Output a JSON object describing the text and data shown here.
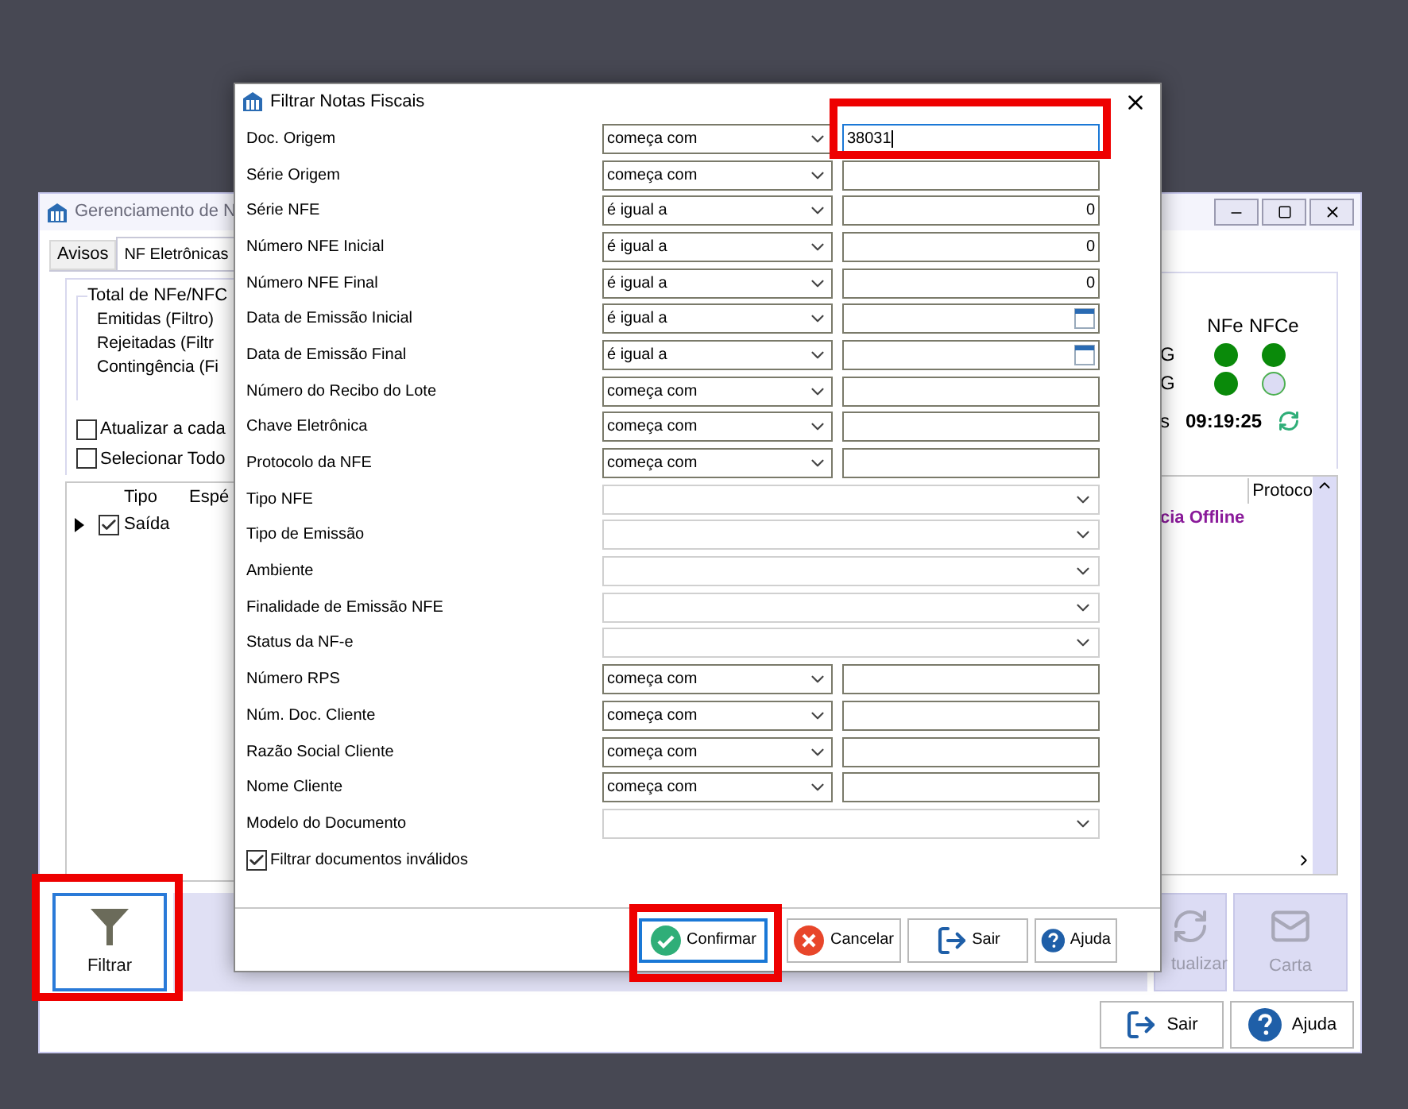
{
  "background_window": {
    "title": "Gerenciamento de N",
    "tabs": [
      {
        "label": "Avisos",
        "selected": false
      },
      {
        "label": "NF Eletrônicas",
        "selected": true
      }
    ],
    "totals": {
      "legend": "Total de NFe/NFC",
      "lines": [
        "Emitidas (Filtro)",
        "Rejeitadas (Filtr",
        "Contingência (Fi"
      ]
    },
    "options": [
      {
        "label": "Atualizar a cada",
        "checked": false
      },
      {
        "label": "Selecionar Todo",
        "checked": false
      }
    ],
    "status": {
      "columns": [
        "NFe",
        "NFCe"
      ],
      "rows": [
        {
          "label": "G",
          "lights": [
            {
              "on": true
            },
            {
              "on": true
            }
          ]
        },
        {
          "label": "G",
          "lights": [
            {
              "on": true
            },
            {
              "on": false
            }
          ]
        }
      ],
      "time_label": "s",
      "time": "09:19:25"
    },
    "grid": {
      "columns": [
        "Tipo",
        "Espé"
      ],
      "column_right": "Protoco",
      "rows": [
        {
          "selected": true,
          "checked": true,
          "tipo": "Saída",
          "status": "cia Offline"
        }
      ]
    },
    "toolbar": [
      {
        "label": "Filtrar",
        "kind": "filter",
        "enabled": true
      },
      {
        "label": "tualizar",
        "kind": "refresh",
        "enabled": false
      },
      {
        "label": "Carta",
        "kind": "mail",
        "enabled": false
      }
    ],
    "footer_buttons": [
      {
        "label": "Sair",
        "kind": "exit"
      },
      {
        "label": "Ajuda",
        "kind": "help"
      }
    ]
  },
  "dialog": {
    "title": "Filtrar Notas Fiscais",
    "rows": [
      {
        "label": "Doc. Origem",
        "kind": "operator",
        "operator": "começa com",
        "value": "38031",
        "focused": true
      },
      {
        "label": "Série Origem",
        "kind": "operator",
        "operator": "começa com",
        "focused": false
      },
      {
        "label": "Série NFE",
        "kind": "operator",
        "operator": "é igual a",
        "value": "0",
        "focused": false
      },
      {
        "label": "Número NFE Inicial",
        "kind": "operator",
        "operator": "é igual a",
        "value": "0",
        "focused": false
      },
      {
        "label": "Número NFE Final",
        "kind": "operator",
        "operator": "é igual a",
        "value": "0",
        "focused": false
      },
      {
        "label": "Data de Emissão Inicial",
        "kind": "date",
        "operator": "é igual a",
        "focused": false
      },
      {
        "label": "Data de Emissão Final",
        "kind": "date",
        "operator": "é igual a",
        "focused": false
      },
      {
        "label": "Número do Recibo do Lote",
        "kind": "operator",
        "operator": "começa com",
        "focused": false
      },
      {
        "label": "Chave Eletrônica",
        "kind": "operator",
        "operator": "começa com",
        "focused": false
      },
      {
        "label": "Protocolo da NFE",
        "kind": "operator",
        "operator": "começa com",
        "focused": false
      },
      {
        "label": "Tipo NFE",
        "kind": "select"
      },
      {
        "label": "Tipo de Emissão",
        "kind": "select"
      },
      {
        "label": "Ambiente",
        "kind": "select"
      },
      {
        "label": "Finalidade de Emissão NFE",
        "kind": "select"
      },
      {
        "label": "Status da NF-e",
        "kind": "select"
      },
      {
        "label": "Número RPS",
        "kind": "operator",
        "operator": "começa com",
        "focused": false
      },
      {
        "label": "Núm. Doc. Cliente",
        "kind": "operator",
        "operator": "começa com",
        "focused": false
      },
      {
        "label": "Razão Social Cliente",
        "kind": "operator",
        "operator": "começa com",
        "focused": false
      },
      {
        "label": "Nome Cliente",
        "kind": "operator",
        "operator": "começa com",
        "focused": false
      },
      {
        "label": "Modelo do Documento",
        "kind": "select"
      }
    ],
    "invalid_filter": {
      "label": "Filtrar documentos inválidos",
      "checked": true
    },
    "buttons": [
      {
        "label": "Confirmar",
        "kind": "confirm",
        "focused": true
      },
      {
        "label": "Cancelar",
        "kind": "cancel",
        "focused": false
      },
      {
        "label": "Sair",
        "kind": "exit",
        "focused": false
      },
      {
        "label": "Ajuda",
        "kind": "help",
        "focused": false
      }
    ]
  }
}
